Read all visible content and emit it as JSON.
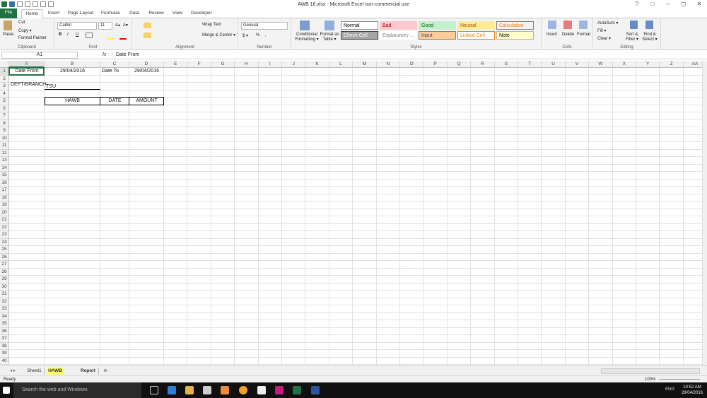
{
  "window": {
    "title": "AWB 16.xlsx - Microsoft Excel non-commercial use",
    "controls": [
      "?",
      "□",
      "–",
      "◻",
      "✕"
    ]
  },
  "tabs": [
    "File",
    "Home",
    "Insert",
    "Page Layout",
    "Formulas",
    "Data",
    "Review",
    "View",
    "Developer"
  ],
  "ribbon": {
    "clipboard": {
      "label": "Clipboard",
      "paste": "Paste",
      "cut": "Cut",
      "copy": "Copy ▾",
      "format_painter": "Format Painter"
    },
    "font": {
      "label": "Font",
      "name": "Calibri",
      "size": "11",
      "grow": "A▴",
      "shrink": "A▾",
      "bold": "B",
      "italic": "I",
      "underline": "U"
    },
    "alignment": {
      "label": "Alignment",
      "wrap": "Wrap Text",
      "merge": "Merge & Center ▾"
    },
    "number": {
      "label": "Number",
      "format": "General",
      "currency": "$ ▾",
      "percent": "%",
      "comma": ","
    },
    "styles": {
      "label": "Styles",
      "conditional": "Conditional Formatting ▾",
      "format_table": "Format as Table ▾",
      "cells": [
        {
          "name": "Normal",
          "bg": "#ffffff",
          "fg": "#000000",
          "border": "#8e8e8e"
        },
        {
          "name": "Bad",
          "bg": "#ffc7ce",
          "fg": "#9c0006",
          "border": "#ffc7ce"
        },
        {
          "name": "Good",
          "bg": "#c6efce",
          "fg": "#006100",
          "border": "#c6efce"
        },
        {
          "name": "Neutral",
          "bg": "#ffeb9c",
          "fg": "#9c5700",
          "border": "#ffeb9c"
        },
        {
          "name": "Calculation",
          "bg": "#f2f2f2",
          "fg": "#fa7d00",
          "border": "#7f7f7f"
        },
        {
          "name": "Check Cell",
          "bg": "#a5a5a5",
          "fg": "#ffffff",
          "border": "#3f3f3f"
        },
        {
          "name": "Explanatory ...",
          "bg": "#ffffff",
          "fg": "#7f7f7f",
          "border": "#ffffff"
        },
        {
          "name": "Input",
          "bg": "#ffcc99",
          "fg": "#3f3f76",
          "border": "#7f7f7f"
        },
        {
          "name": "Linked Cell",
          "bg": "#ffffff",
          "fg": "#fa7d00",
          "border": "#fa7d00"
        },
        {
          "name": "Note",
          "bg": "#ffffcc",
          "fg": "#000000",
          "border": "#b2b2b2"
        }
      ]
    },
    "cells": {
      "label": "Cells",
      "insert": "Insert",
      "delete": "Delete",
      "format": "Format"
    },
    "editing": {
      "label": "Editing",
      "autosum": "AutoSum ▾",
      "fill": "Fill ▾",
      "clear": "Clear ▾",
      "sort": "Sort & Filter ▾",
      "find": "Find & Select ▾"
    }
  },
  "formula_bar": {
    "name_box": "A1",
    "fx": "fx",
    "content": "Date From"
  },
  "columns": [
    "A",
    "B",
    "C",
    "D",
    "E",
    "F",
    "G",
    "H",
    "I",
    "J",
    "K",
    "L",
    "M",
    "N",
    "O",
    "P",
    "Q",
    "R",
    "S",
    "T",
    "U",
    "V",
    "W",
    "X",
    "Y",
    "Z",
    "AA"
  ],
  "row_count": 40,
  "cells": {
    "A1": "Date From",
    "B1": "29/04/2016",
    "C1": "Date To",
    "D1": "29/04/2016",
    "A3": "DEPT/BRANCH",
    "B3": "TSU",
    "B5": "HAWB",
    "C5": "DATE",
    "D5": "AMOUNT"
  },
  "sheets": [
    {
      "name": "Sheet1",
      "active": false
    },
    {
      "name": "HAWB",
      "active": true
    },
    {
      "name": "Report",
      "active": false
    }
  ],
  "status": {
    "mode": "Ready",
    "zoom": "100%"
  },
  "taskbar": {
    "search_placeholder": "Search the web and Windows",
    "language": "ENG",
    "time": "10:52 AM",
    "date": "29/04/2016"
  }
}
